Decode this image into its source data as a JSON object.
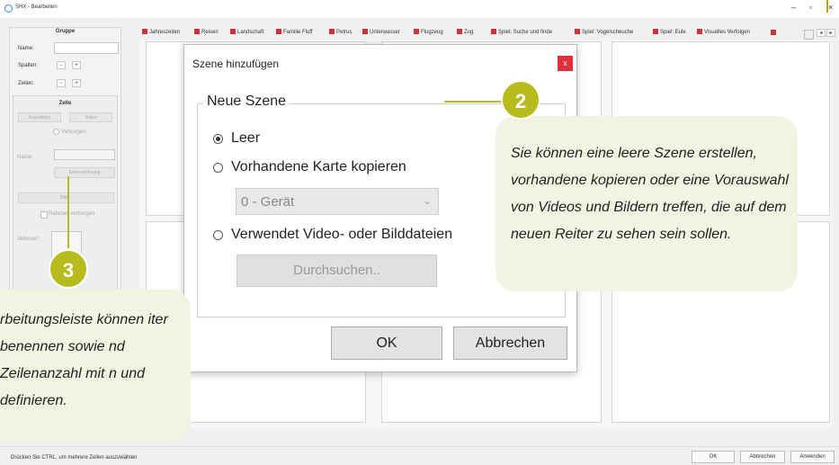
{
  "window": {
    "title": "SHX - Bearbeiten",
    "minimize_glyph": "–",
    "maximize_glyph": "▫",
    "close_glyph": "×"
  },
  "sidebar": {
    "group_header": "Gruppe",
    "name_label": "Name:",
    "name_value": "",
    "columns_label": "Spalten:",
    "rows_label": "Zeilen:",
    "minus": "-",
    "plus": "+",
    "cell_header": "Zelle",
    "select_button": "Auswählen",
    "split_button": "Teilen",
    "hidden_label": "Verborgen",
    "cell_name_label": "Name:",
    "cell_name_button": "Kennzeichnung",
    "image_button": "Bild...",
    "frame_hidden_label": "Rahmen verbergen",
    "actions_label": "Aktionen:"
  },
  "tabs": [
    {
      "label": "Jahreszeiten"
    },
    {
      "label": "Reisen"
    },
    {
      "label": "Landschaft"
    },
    {
      "label": "Familie Fluff"
    },
    {
      "label": "Petrus"
    },
    {
      "label": "Unterwasser"
    },
    {
      "label": "Flugzeug"
    },
    {
      "label": "Zug"
    },
    {
      "label": "Spiel: Suche und finde"
    },
    {
      "label": "Spiel: Vogelscheuche"
    },
    {
      "label": "Spiel: Eule"
    },
    {
      "label": "Visuelles Verfolgen"
    }
  ],
  "tab_nav": {
    "prev": "◂",
    "next": "▸"
  },
  "status": {
    "hint": "Drücken Sie CTRL, um mehrere Zellen auszuwählen",
    "ok": "OK",
    "cancel": "Abbrechen",
    "apply": "Anwenden"
  },
  "dialog": {
    "title": "Szene hinzufügen",
    "close": "x",
    "group_label": "Neue Szene",
    "options": [
      {
        "label": "Leer",
        "selected": true
      },
      {
        "label": "Vorhandene Karte kopieren",
        "selected": false
      },
      {
        "label": "Verwendet Video- oder Bilddateien",
        "selected": false
      }
    ],
    "map_select_value": "0 - Gerät",
    "browse_button": "Durchsuchen..",
    "ok_button": "OK",
    "cancel_button": "Abbrechen"
  },
  "callouts": [
    {
      "number": "2",
      "text": "Sie können eine leere Szene erstellen, vorhandene kopieren oder eine Vorauswahl von Videos und Bildern treffen, die auf dem neuen Reiter zu sehen sein sollen."
    },
    {
      "number": "3",
      "text": "rbeitungsleiste können iter benennen sowie nd Zeilenanzahl mit n und definieren."
    }
  ],
  "colors": {
    "accent_badge": "#b6bc1d",
    "callout_bg": "#f2f3e1",
    "tab_marker": "#d0303a",
    "close_red": "#e0303a"
  }
}
